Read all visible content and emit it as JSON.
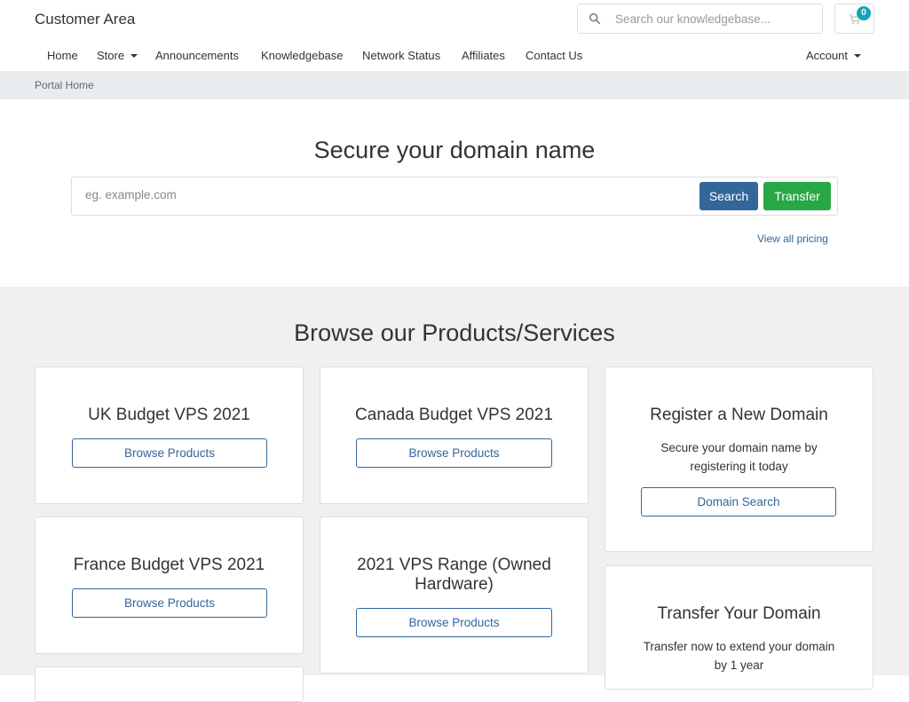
{
  "header": {
    "brand": "Customer Area",
    "kb_search_placeholder": "Search our knowledgebase...",
    "cart_count": "0"
  },
  "nav": {
    "home": "Home",
    "store": "Store",
    "announcements": "Announcements",
    "knowledgebase": "Knowledgebase",
    "network_status": "Network Status",
    "affiliates": "Affiliates",
    "contact_us": "Contact Us",
    "account": "Account"
  },
  "breadcrumb": "Portal Home",
  "domain": {
    "title": "Secure your domain name",
    "placeholder": "eg. example.com",
    "search_label": "Search",
    "transfer_label": "Transfer",
    "pricing_link": "View all pricing"
  },
  "products": {
    "title": "Browse our Products/Services",
    "cards": [
      {
        "title": "UK Budget VPS 2021",
        "button": "Browse Products"
      },
      {
        "title": "Canada Budget VPS 2021",
        "button": "Browse Products"
      },
      {
        "title": "Register a New Domain",
        "description": "Secure your domain name by registering it today",
        "button": "Domain Search"
      },
      {
        "title": "France Budget VPS 2021",
        "button": "Browse Products"
      },
      {
        "title": "2021 VPS Range (Owned Hardware)",
        "button": "Browse Products"
      },
      {
        "title": "Transfer Your Domain",
        "description": "Transfer now to extend your domain by 1 year"
      }
    ]
  },
  "colors": {
    "primary": "#336699",
    "success": "#28a745",
    "badge": "#17a2b8",
    "breadcrumb_bg": "#e9ecef",
    "section_bg": "#f0f0f0"
  }
}
